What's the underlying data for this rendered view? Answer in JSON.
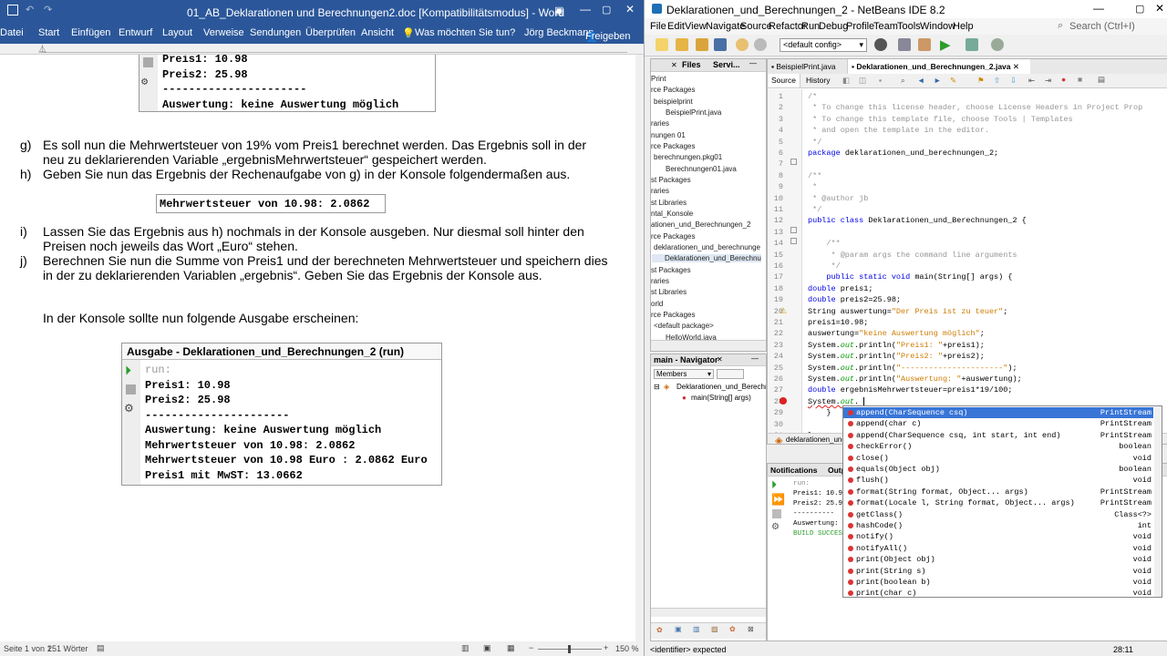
{
  "word": {
    "title": "01_AB_Deklarationen und Berechnungen2.doc [Kompatibilitätsmodus]  -  Word",
    "tabs": [
      "Datei",
      "Start",
      "Einfügen",
      "Entwurf",
      "Layout",
      "Verweise",
      "Sendungen",
      "Überprüfen",
      "Ansicht"
    ],
    "tellme": "Was möchten Sie tun?",
    "user": "Jörg Beckmann",
    "share": "Freigeben",
    "top_box": [
      "Preis1: 10.98",
      "Preis2: 25.98",
      "----------------------",
      "Auswertung: keine Auswertung möglich"
    ],
    "para_g_lbl": "g)",
    "para_g": "Es soll nun die Mehrwertsteuer von 19% vom Preis1 berechnet werden. Das Ergebnis soll in der neu zu deklarierenden Variable „ergebnisMehrwertsteuer“ gespeichert werden.",
    "para_h_lbl": "h)",
    "para_h": "Geben Sie nun das Ergebnis der Rechenaufgabe von g) in der Konsole folgendermaßen aus.",
    "mwst_box": "Mehrwertsteuer von 10.98: 2.0862",
    "para_i_lbl": "i)",
    "para_i": "Lassen Sie das Ergebnis aus h) nochmals in der Konsole ausgeben. Nur diesmal soll hinter den Preisen noch jeweils das Wort „Euro“ stehen.",
    "para_j_lbl": "j)",
    "para_j": "Berechnen Sie nun die Summe von Preis1 und der berechneten Mehrwertsteuer und speichern dies in der zu deklarierenden Variablen „ergebnis“. Geben Sie das Ergebnis der Konsole aus.",
    "konsole_intro": "In der Konsole sollte nun folgende Ausgabe erscheinen:",
    "out_title": "Ausgabe - Deklarationen_und_Berechnungen_2 (run)",
    "out_lines": [
      "run:",
      "Preis1: 10.98",
      "Preis2: 25.98",
      "----------------------",
      "Auswertung: keine Auswertung möglich",
      "Mehrwertsteuer von 10.98: 2.0862",
      "Mehrwertsteuer von 10.98 Euro : 2.0862 Euro",
      "Preis1 mit MwST: 13.0662"
    ],
    "status_page": "Seite 1 von 1",
    "status_words": "251 Wörter",
    "zoom": "150 %"
  },
  "nb": {
    "title": "Deklarationen_und_Berechnungen_2 - NetBeans IDE 8.2",
    "menu": [
      "File",
      "Edit",
      "View",
      "Navigate",
      "Source",
      "Refactor",
      "Run",
      "Debug",
      "Profile",
      "Team",
      "Tools",
      "Window",
      "Help"
    ],
    "search_placeholder": "Search (Ctrl+I)",
    "config": "<default config>",
    "proj_tabs": [
      "Files",
      "Servi..."
    ],
    "proj_rows": [
      "Print",
      "rce Packages",
      "beispielprint",
      "BeispielPrint.java",
      "raries",
      "nungen 01",
      "rce Packages",
      "berechnungen.pkg01",
      "Berechnungen01.java",
      "st Packages",
      "raries",
      "st Libraries",
      "ntal_Konsole",
      "ationen_und_Berechnungen_2",
      "rce Packages",
      "deklarationen_und_berechnunge",
      "Deklarationen_und_Berechnu",
      "st Packages",
      "raries",
      "st Libraries",
      "orld",
      "rce Packages",
      "<default package>",
      "HelloWorld.java"
    ],
    "nav_title": "main - Navigator",
    "nav_members": "Members",
    "nav_class": "Deklarationen_und_Berechn",
    "nav_method": "main(String[] args)",
    "editor_tabs": [
      "BeispielPrint.java",
      "Deklarationen_und_Berechnungen_2.java"
    ],
    "source_tab": "Source",
    "history_tab": "History",
    "line_numbers": [
      "1",
      "2",
      "3",
      "4",
      "5",
      "6",
      "7",
      "8",
      "9",
      "10",
      "11",
      "12",
      "13",
      "14",
      "15",
      "16",
      "17",
      "18",
      "19",
      "20",
      "21",
      "22",
      "23",
      "24",
      "25",
      "26",
      "27",
      "28",
      "29",
      "30",
      "31"
    ],
    "code": {
      "l1": "/*",
      "l2": " * To change this license header, choose License Headers in Project Prop",
      "l3": " * To change this template file, choose Tools | Templates",
      "l4": " * and open the template in the editor.",
      "l5": " */",
      "l6a": "package",
      "l6b": " deklarationen_und_berechnungen_2;",
      "l8": "/**",
      "l9": " *",
      "l10": " * @author jb",
      "l11": " */",
      "l12a": "public class",
      "l12b": " Deklarationen_und_Berechnungen_2 {",
      "l14": "    /**",
      "l15": "     * @param args the command line arguments",
      "l16": "     */",
      "l17a": "    public static void",
      "l17b": " main(String[] args) {",
      "l18a": "double",
      "l18b": " preis1;",
      "l19a": "double",
      "l19b": " preis2=25.98;",
      "l20a": "String auswertung=",
      "l20b": "\"Der Preis ist zu teuer\"",
      "l20c": ";",
      "l21": "preis1=10.98;",
      "l22a": "auswertung=",
      "l22b": "\"keine Auswertung möglich\"",
      "l22c": ";",
      "l23a": "System.",
      "l23b": "out",
      "l23c": ".println(",
      "l23d": "\"Preis1: \"",
      "l23e": "+preis1);",
      "l24a": "System.",
      "l24b": "out",
      "l24c": ".println(",
      "l24d": "\"Preis2: \"",
      "l24e": "+preis2);",
      "l25a": "System.",
      "l25b": "out",
      "l25c": ".println(",
      "l25d": "\"----------------------\"",
      "l25e": ");",
      "l26a": "System.",
      "l26b": "out",
      "l26c": ".println(",
      "l26d": "\"Auswertung: \"",
      "l26e": "+auswertung);",
      "l27a": "double",
      "l27b": " ergebnisMehrwertsteuer=preis1*19/100;",
      "l28a": "System.",
      "l28b": "out",
      "l28c": ".",
      "l29": "    }",
      "l31": "}"
    },
    "ac_items": [
      {
        "name": "append(CharSequence csq)",
        "type": "PrintStream"
      },
      {
        "name": "append(char c)",
        "type": "PrintStream"
      },
      {
        "name": "append(CharSequence csq, int start, int end)",
        "type": "PrintStream"
      },
      {
        "name": "checkError()",
        "type": "boolean"
      },
      {
        "name": "close()",
        "type": "void"
      },
      {
        "name": "equals(Object obj)",
        "type": "boolean"
      },
      {
        "name": "flush()",
        "type": "void"
      },
      {
        "name": "format(String format, Object... args)",
        "type": "PrintStream"
      },
      {
        "name": "format(Locale l, String format, Object... args)",
        "type": "PrintStream"
      },
      {
        "name": "getClass()",
        "type": "Class<?>"
      },
      {
        "name": "hashCode()",
        "type": "int"
      },
      {
        "name": "notify()",
        "type": "void"
      },
      {
        "name": "notifyAll()",
        "type": "void"
      },
      {
        "name": "print(Object obj)",
        "type": "void"
      },
      {
        "name": "print(String s)",
        "type": "void"
      },
      {
        "name": "print(boolean b)",
        "type": "void"
      },
      {
        "name": "print(char c)",
        "type": "void"
      }
    ],
    "breadcrumb": "deklarationen_und",
    "out_tabs": [
      "Notifications",
      "Outp"
    ],
    "out_lines": [
      "run:",
      "Preis1: 10.9",
      "Preis2: 25.9",
      "----------",
      "Auswertung:",
      "BUILD SUCCES"
    ],
    "status_left": "<identifier> expected",
    "status_right": "28:11"
  }
}
